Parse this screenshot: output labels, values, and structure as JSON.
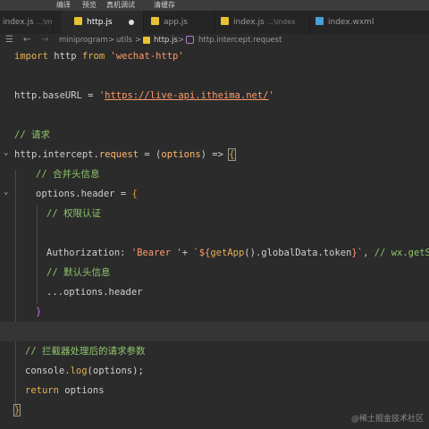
{
  "menu": {
    "items": [
      "编译",
      "预览",
      "真机调试",
      "清缓存"
    ]
  },
  "tabs": [
    {
      "label": "index.js",
      "suffix": "...\\my"
    },
    {
      "label": "http.js",
      "suffix": ""
    },
    {
      "label": "app.js",
      "suffix": ""
    },
    {
      "label": "index.js",
      "suffix": "...\\index"
    },
    {
      "label": "index.wxml",
      "suffix": ""
    }
  ],
  "breadcrumb": {
    "items": [
      "miniprogram",
      "utils",
      "http.js",
      "http.intercept.request"
    ],
    "separator": ">"
  },
  "code": {
    "l1": {
      "import": "import",
      "name": "http",
      "from": "from",
      "module": "'wechat-http'"
    },
    "l2": {
      "obj": "http.baseURL = ",
      "q1": "'",
      "url": "https://live-api.itheima.net/",
      "q2": "'"
    },
    "l3": {
      "comment": "// 请求"
    },
    "l4": {
      "a": "http.intercept.",
      "prop": "request",
      "b": " = (",
      "param": "options",
      "c": ") => ",
      "brace": "{"
    },
    "l5": {
      "comment": "// 合并头信息"
    },
    "l6": {
      "a": "options.header = ",
      "brace": "{"
    },
    "l7": {
      "comment": "// 权限认证"
    },
    "l8": {
      "key": "Authorization: ",
      "s1": "'Bearer '",
      "plus": "+ ",
      "tpl1": "`${",
      "fn": "getApp",
      "mid": "().globalData.token",
      "tpl2": "}`",
      "comma": ", ",
      "comment": "// wx.getStor"
    },
    "l9": {
      "comment": "// 默认头信息"
    },
    "l10": {
      "text": "...options.header"
    },
    "l11": {
      "brace": "}"
    },
    "l13": {
      "comment": "// 拦截器处理后的请求参数"
    },
    "l14": {
      "a": "console.",
      "fn": "log",
      "b": "(options);"
    },
    "l15": {
      "kw": "return",
      "b": " options"
    },
    "l16": {
      "brace": "}"
    }
  },
  "watermark": "@稀土掘金技术社区",
  "colors": {
    "background": "#2b2b2b",
    "keyword": "#e8b24c",
    "string": "#ff9a6a",
    "comment": "#8fc56b",
    "tab_icon": "#e8c233"
  }
}
